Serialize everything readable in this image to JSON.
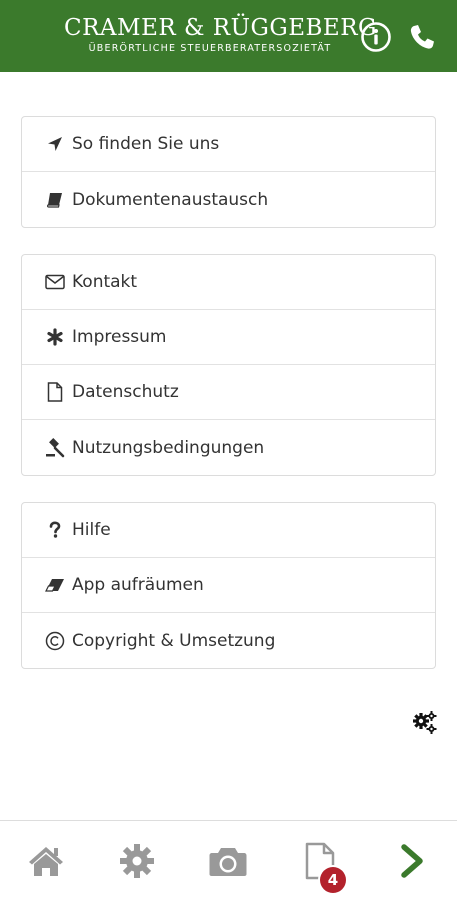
{
  "header": {
    "title": "CRAMER & RÜGGEBERG",
    "subtitle": "ÜBERÖRTLICHE STEUERBERATERSOZIETÄT",
    "info_icon": "info-circle-icon",
    "phone_icon": "phone-icon",
    "background_color": "#3b7a2c"
  },
  "menu_groups": [
    {
      "items": [
        {
          "label": "So finden Sie uns",
          "icon": "location-arrow-icon"
        },
        {
          "label": "Dokumentenaustausch",
          "icon": "book-icon"
        }
      ]
    },
    {
      "items": [
        {
          "label": "Kontakt",
          "icon": "envelope-icon"
        },
        {
          "label": "Impressum",
          "icon": "asterisk-icon"
        },
        {
          "label": "Datenschutz",
          "icon": "file-icon"
        },
        {
          "label": "Nutzungsbedingungen",
          "icon": "gavel-icon"
        }
      ]
    },
    {
      "items": [
        {
          "label": "Hilfe",
          "icon": "question-icon"
        },
        {
          "label": "App aufräumen",
          "icon": "eraser-icon"
        },
        {
          "label": "Copyright & Umsetzung",
          "icon": "copyright-icon"
        }
      ]
    }
  ],
  "settings_icon": "gears-icon",
  "bottom_bar": {
    "tabs": [
      {
        "icon": "home-icon"
      },
      {
        "icon": "gear-icon"
      },
      {
        "icon": "camera-icon"
      },
      {
        "icon": "document-icon"
      },
      {
        "icon": "chevron-right-icon"
      }
    ],
    "document_badge": "4",
    "badge_color": "#b3222c",
    "accent_color": "#3b7a2c"
  }
}
